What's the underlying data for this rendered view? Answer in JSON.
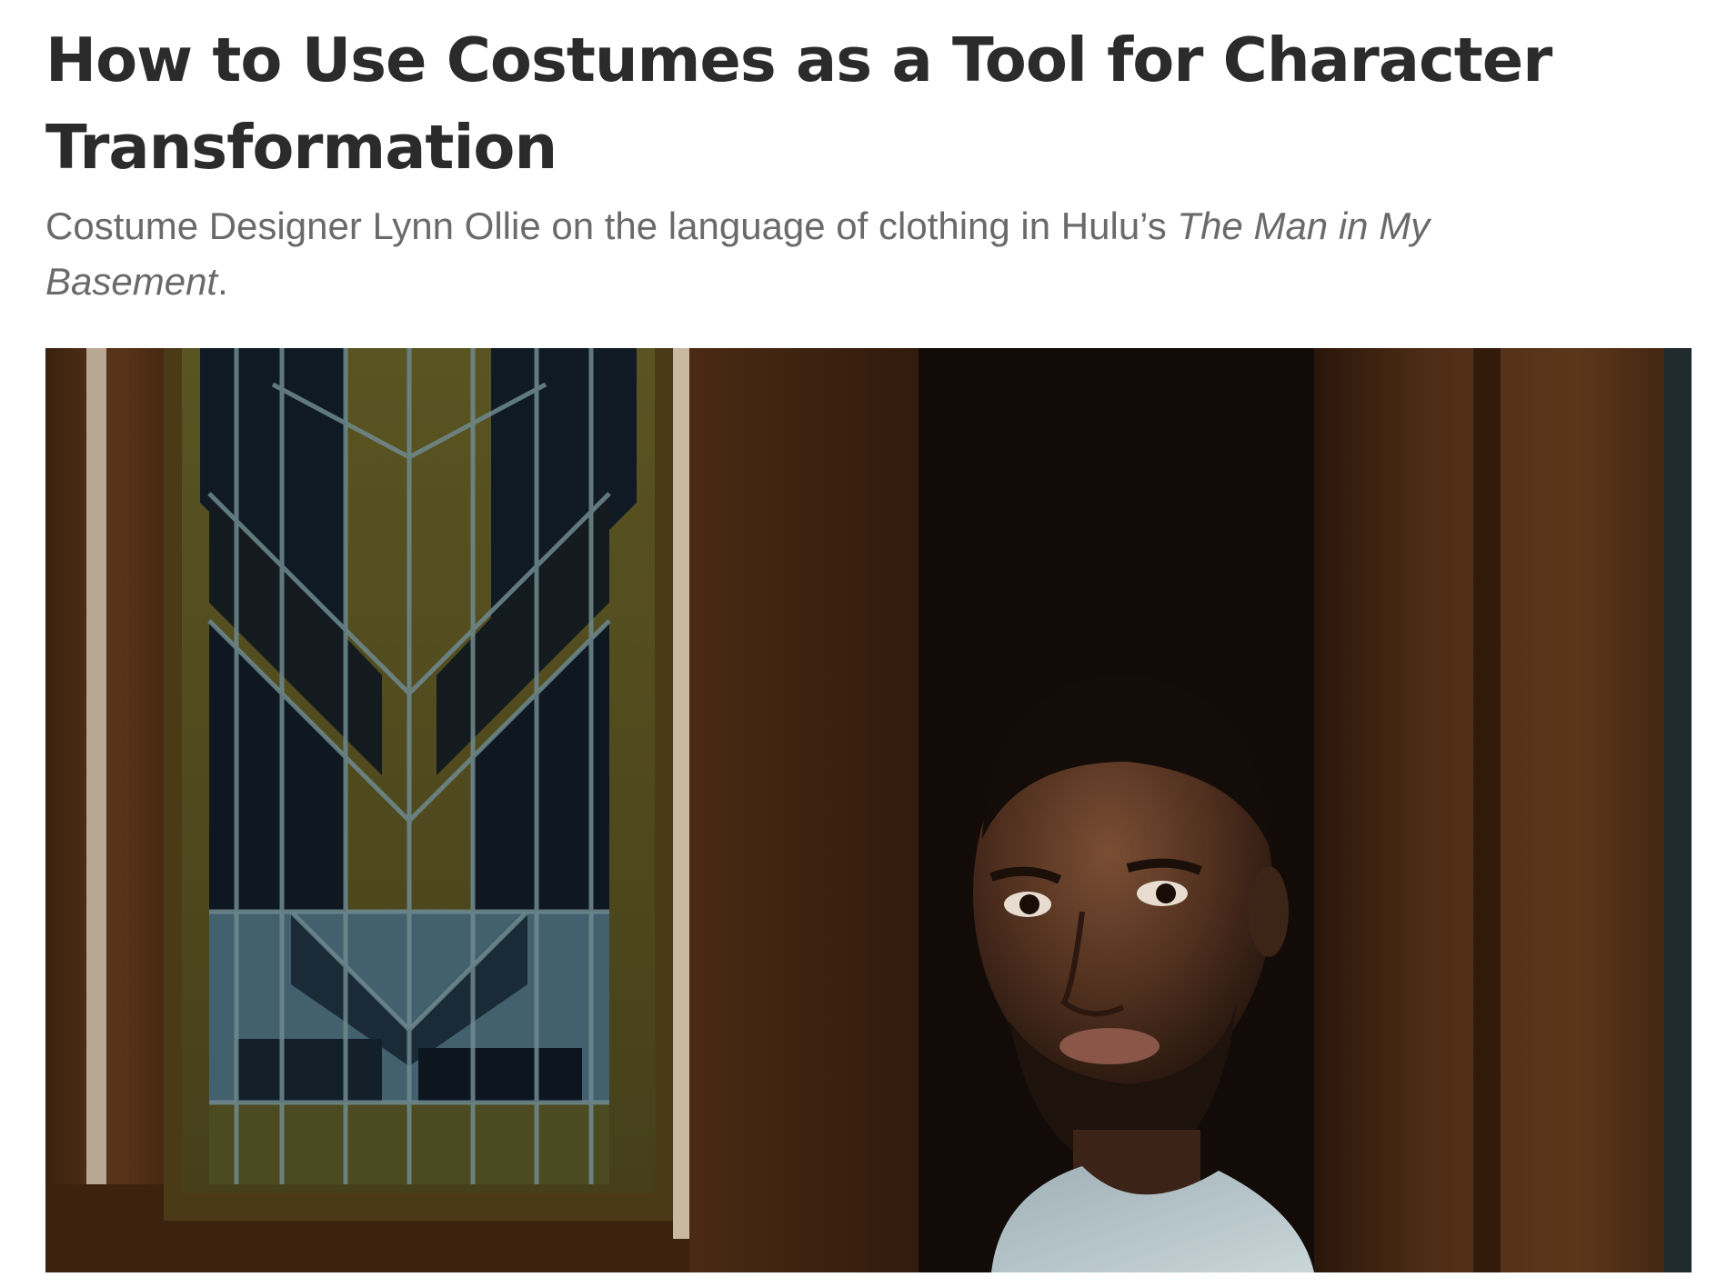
{
  "article": {
    "headline": "How to Use Costumes as a Tool for Character Transformation",
    "dek_prefix": "Costume Designer Lynn Ollie on the language of clothing in Hulu’s ",
    "dek_title": "The Man in My Basement",
    "dek_suffix": "."
  },
  "hero_image": {
    "subject": "man peering from behind a dark wooden door next to a stained-glass window panel"
  }
}
